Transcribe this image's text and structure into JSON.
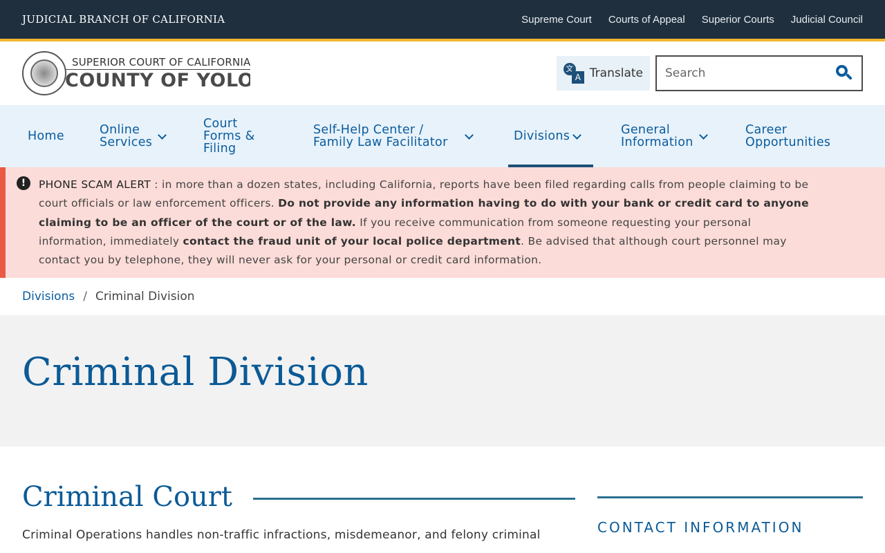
{
  "topbar": {
    "brand": "JUDICIAL BRANCH OF CALIFORNIA",
    "links": [
      "Supreme Court",
      "Courts of Appeal",
      "Superior Courts",
      "Judicial Council"
    ]
  },
  "header": {
    "logo_sub": "SUPERIOR COURT OF CALIFORNIA",
    "logo_main": "COUNTY OF YOLO",
    "translate_label": "Translate",
    "search_placeholder": "Search"
  },
  "nav": {
    "items": [
      {
        "label": "Home",
        "line2": ""
      },
      {
        "label": "Online",
        "line2": "Services"
      },
      {
        "label": "Court Forms & Filing",
        "line2": ""
      },
      {
        "label": "Self-Help Center /",
        "line2": "Family Law Facilitator"
      },
      {
        "label": "Divisions",
        "line2": ""
      },
      {
        "label": "General",
        "line2": "Information"
      },
      {
        "label": "Career",
        "line2": "Opportunities"
      }
    ]
  },
  "alert": {
    "title": "PHONE SCAM ALERT",
    "text1": " : in more than a dozen states, including California, reports have been filed regarding calls from people claiming to be court officials or law enforcement officers. ",
    "bold1": "Do not provide any information having to do with your bank or credit card to anyone claiming to be an officer of the court or of the law.",
    "text2": " If you receive communication from someone requesting your personal information, immediately ",
    "bold2": "contact the fraud unit of your local police department",
    "text3": ". Be advised that although court personnel may contact you by telephone, they will never ask for your personal or credit card information."
  },
  "breadcrumb": {
    "parent": "Divisions",
    "separator": "/",
    "current": "Criminal Division"
  },
  "hero": {
    "title": "Criminal Division"
  },
  "content": {
    "section_title": "Criminal Court",
    "intro": "Criminal Operations handles non-traffic infractions, misdemeanor, and felony criminal",
    "sidebar_title": "CONTACT INFORMATION"
  }
}
